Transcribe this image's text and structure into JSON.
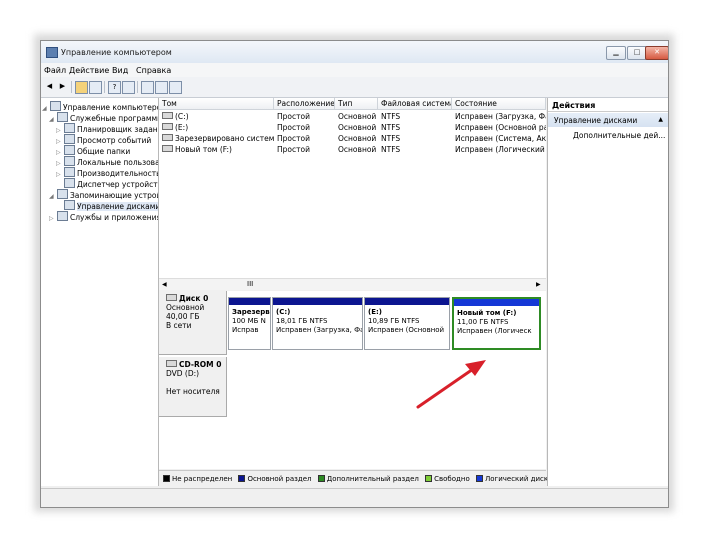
{
  "window": {
    "title": "Управление компьютером",
    "controls": {
      "minimize": "▁",
      "maximize": "□",
      "close": "✕"
    }
  },
  "menu": [
    "Файл",
    "Действие",
    "Вид",
    "Справка"
  ],
  "tree": {
    "items": [
      {
        "label": "Управление компьютером (л",
        "icon": "computer-management-icon",
        "arrow": "◢"
      },
      {
        "label": "Служебные программы",
        "icon": "tools-icon",
        "arrow": "◢"
      },
      {
        "label": "Планировщик задани",
        "icon": "task-scheduler-icon",
        "arrow": "▷"
      },
      {
        "label": "Просмотр событий",
        "icon": "event-viewer-icon",
        "arrow": "▷"
      },
      {
        "label": "Общие папки",
        "icon": "shared-folders-icon",
        "arrow": "▷"
      },
      {
        "label": "Локальные пользоват",
        "icon": "local-users-icon",
        "arrow": "▷"
      },
      {
        "label": "Производительность",
        "icon": "performance-icon",
        "arrow": "▷"
      },
      {
        "label": "Диспетчер устройств",
        "icon": "device-manager-icon",
        "arrow": ""
      },
      {
        "label": "Запоминающие устройст",
        "icon": "storage-icon",
        "arrow": "◢"
      },
      {
        "label": "Управление дисками",
        "icon": "disk-management-icon",
        "arrow": ""
      },
      {
        "label": "Службы и приложения",
        "icon": "services-icon",
        "arrow": "▷"
      }
    ]
  },
  "volumes": {
    "columns": [
      "Том",
      "Расположение",
      "Тип",
      "Файловая система",
      "Состояние"
    ],
    "rows": [
      [
        "(C:)",
        "Простой",
        "Основной",
        "NTFS",
        "Исправен (Загрузка, Фа"
      ],
      [
        "(E:)",
        "Простой",
        "Основной",
        "NTFS",
        "Исправен (Основной раз"
      ],
      [
        "Зарезервировано системой",
        "Простой",
        "Основной",
        "NTFS",
        "Исправен (Система, Акти"
      ],
      [
        "Новый том (F:)",
        "Простой",
        "Основной",
        "NTFS",
        "Исправен (Логический д"
      ]
    ],
    "scroll_marker": "III"
  },
  "disks": [
    {
      "name": "Диск 0",
      "lines": [
        "Основной",
        "40,00 ГБ",
        "В сети"
      ],
      "partitions": [
        {
          "title": "Зарезерв",
          "size": "100 МБ N",
          "status": "Исправ"
        },
        {
          "title": "(C:)",
          "size": "18,01 ГБ NTFS",
          "status": "Исправен (Загрузка, Фа"
        },
        {
          "title": "(E:)",
          "size": "10,89 ГБ NTFS",
          "status": "Исправен (Основной"
        },
        {
          "title": "Новый том  (F:)",
          "size": "11,00 ГБ NTFS",
          "status": "Исправен (Логическ"
        }
      ]
    },
    {
      "name": "CD-ROM 0",
      "lines": [
        "DVD (D:)",
        "",
        "Нет носителя"
      ]
    }
  ],
  "legend": [
    {
      "label": "Не распределен",
      "color": "#000000"
    },
    {
      "label": "Основной раздел",
      "color": "#0c1590"
    },
    {
      "label": "Дополнительный раздел",
      "color": "#2e8b24"
    },
    {
      "label": "Свободно",
      "color": "#7fcf38"
    },
    {
      "label": "Логический диск",
      "color": "#1538d6"
    }
  ],
  "actions": {
    "header": "Действия",
    "section": "Управление дисками",
    "item": "Дополнительные дей..."
  },
  "annotation_color": "#d8202a"
}
